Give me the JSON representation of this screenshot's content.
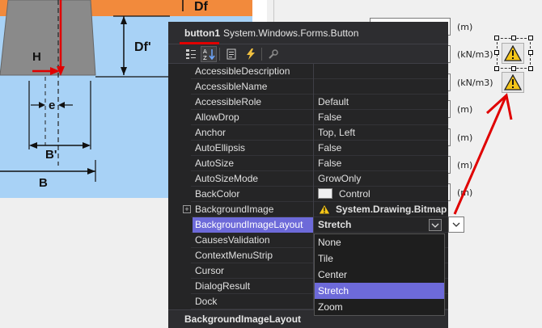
{
  "diagram": {
    "df_label": "Df",
    "dfp_label": "Df'",
    "h_label": "H",
    "e_label": "e",
    "bp_label": "B'",
    "b_label": "B"
  },
  "form": {
    "units": [
      "(m)",
      "(kN/m3)",
      "(kN/m3)",
      "(m)",
      "(m)",
      "(m)",
      "(m)"
    ]
  },
  "properties": {
    "object_name": "button1",
    "object_type": "System.Windows.Forms.Button",
    "toolbar_icons": [
      "categorized-icon",
      "alphabetical-icon",
      "properties-icon",
      "events-icon",
      "property-pages-icon"
    ],
    "rows": [
      {
        "name": "AccessibleDescription",
        "value": ""
      },
      {
        "name": "AccessibleName",
        "value": ""
      },
      {
        "name": "AccessibleRole",
        "value": "Default"
      },
      {
        "name": "AllowDrop",
        "value": "False"
      },
      {
        "name": "Anchor",
        "value": "Top, Left"
      },
      {
        "name": "AutoEllipsis",
        "value": "False"
      },
      {
        "name": "AutoSize",
        "value": "False"
      },
      {
        "name": "AutoSizeMode",
        "value": "GrowOnly"
      },
      {
        "name": "BackColor",
        "value": "Control"
      },
      {
        "name": "BackgroundImage",
        "value": "System.Drawing.Bitmap"
      },
      {
        "name": "BackgroundImageLayout",
        "value": "Stretch"
      },
      {
        "name": "CausesValidation",
        "value": ""
      },
      {
        "name": "ContextMenuStrip",
        "value": ""
      },
      {
        "name": "Cursor",
        "value": ""
      },
      {
        "name": "DialogResult",
        "value": ""
      },
      {
        "name": "Dock",
        "value": ""
      }
    ],
    "description_title": "BackgroundImageLayout"
  },
  "dropdown": {
    "options": [
      "None",
      "Tile",
      "Center",
      "Stretch",
      "Zoom"
    ],
    "selected": "Stretch"
  },
  "colors": {
    "orange": "#f28a3c",
    "water_blue": "#a8d2f6",
    "selection": "#6d6ad9",
    "annotation_red": "#e00000",
    "dark_panel": "#252526"
  }
}
